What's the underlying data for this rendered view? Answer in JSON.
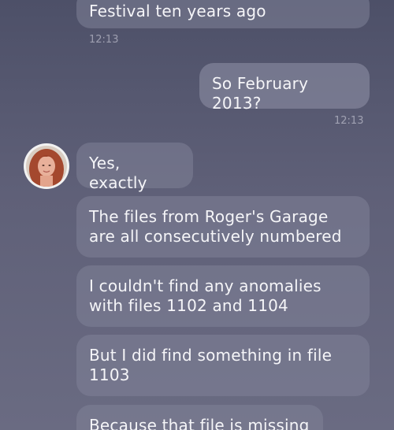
{
  "messages": [
    {
      "text": "Festival ten years ago",
      "direction": "incoming"
    },
    {
      "text": "So February 2013?",
      "direction": "outgoing"
    },
    {
      "text": "Yes, exactly",
      "direction": "incoming"
    },
    {
      "text": "The files from Roger's Garage are all consecutively numbered",
      "direction": "incoming"
    },
    {
      "text": "I couldn't find any anomalies with files 1102 and 1104",
      "direction": "incoming"
    },
    {
      "text": "But I did find something in file 1103",
      "direction": "incoming"
    },
    {
      "text": "Because that file is missing",
      "direction": "incoming"
    }
  ],
  "timestamps": [
    "12:13",
    "12:13"
  ],
  "colors": {
    "background_top": "#4d5068",
    "background_bottom": "#6a6b82",
    "bubble": "#8082984d",
    "text": "#f5f5f8"
  }
}
